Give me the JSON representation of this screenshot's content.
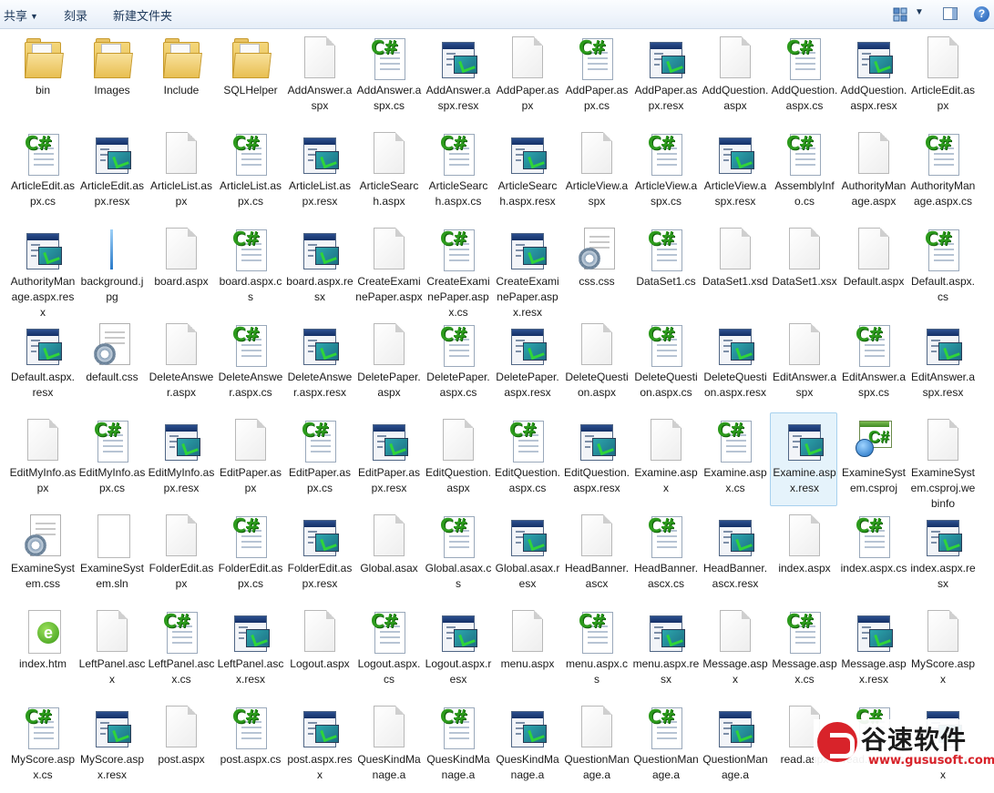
{
  "toolbar": {
    "share_label": "共享",
    "burn_label": "刻录",
    "new_folder_label": "新建文件夹",
    "help_label": "?"
  },
  "files": [
    {
      "name": "bin",
      "type": "folder"
    },
    {
      "name": "Images",
      "type": "folder"
    },
    {
      "name": "Include",
      "type": "folder"
    },
    {
      "name": "SQLHelper",
      "type": "folder"
    },
    {
      "name": "AddAnswer.aspx",
      "type": "page"
    },
    {
      "name": "AddAnswer.aspx.cs",
      "type": "cs"
    },
    {
      "name": "AddAnswer.aspx.resx",
      "type": "resx"
    },
    {
      "name": "AddPaper.aspx",
      "type": "page"
    },
    {
      "name": "AddPaper.aspx.cs",
      "type": "cs"
    },
    {
      "name": "AddPaper.aspx.resx",
      "type": "resx"
    },
    {
      "name": "AddQuestion.aspx",
      "type": "page"
    },
    {
      "name": "AddQuestion.aspx.cs",
      "type": "cs"
    },
    {
      "name": "AddQuestion.aspx.resx",
      "type": "resx"
    },
    {
      "name": "ArticleEdit.aspx",
      "type": "page"
    },
    {
      "name": "ArticleEdit.aspx.cs",
      "type": "cs"
    },
    {
      "name": "ArticleEdit.aspx.resx",
      "type": "resx"
    },
    {
      "name": "ArticleList.aspx",
      "type": "page"
    },
    {
      "name": "ArticleList.aspx.cs",
      "type": "cs"
    },
    {
      "name": "ArticleList.aspx.resx",
      "type": "resx"
    },
    {
      "name": "ArticleSearch.aspx",
      "type": "page"
    },
    {
      "name": "ArticleSearch.aspx.cs",
      "type": "cs"
    },
    {
      "name": "ArticleSearch.aspx.resx",
      "type": "resx"
    },
    {
      "name": "ArticleView.aspx",
      "type": "page"
    },
    {
      "name": "ArticleView.aspx.cs",
      "type": "cs"
    },
    {
      "name": "ArticleView.aspx.resx",
      "type": "resx"
    },
    {
      "name": "AssemblyInfo.cs",
      "type": "cs"
    },
    {
      "name": "AuthorityManage.aspx",
      "type": "page"
    },
    {
      "name": "AuthorityManage.aspx.cs",
      "type": "cs"
    },
    {
      "name": "AuthorityManage.aspx.resx",
      "type": "resx"
    },
    {
      "name": "background.jpg",
      "type": "jpg"
    },
    {
      "name": "board.aspx",
      "type": "page"
    },
    {
      "name": "board.aspx.cs",
      "type": "cs"
    },
    {
      "name": "board.aspx.resx",
      "type": "resx"
    },
    {
      "name": "CreateExaminePaper.aspx",
      "type": "page"
    },
    {
      "name": "CreateExaminePaper.aspx.cs",
      "type": "cs"
    },
    {
      "name": "CreateExaminePaper.aspx.resx",
      "type": "resx"
    },
    {
      "name": "css.css",
      "type": "css"
    },
    {
      "name": "DataSet1.cs",
      "type": "cs"
    },
    {
      "name": "DataSet1.xsd",
      "type": "page"
    },
    {
      "name": "DataSet1.xsx",
      "type": "page"
    },
    {
      "name": "Default.aspx",
      "type": "page"
    },
    {
      "name": "Default.aspx.cs",
      "type": "cs"
    },
    {
      "name": "Default.aspx.resx",
      "type": "resx"
    },
    {
      "name": "default.css",
      "type": "css"
    },
    {
      "name": "DeleteAnswer.aspx",
      "type": "page"
    },
    {
      "name": "DeleteAnswer.aspx.cs",
      "type": "cs"
    },
    {
      "name": "DeleteAnswer.aspx.resx",
      "type": "resx"
    },
    {
      "name": "DeletePaper.aspx",
      "type": "page"
    },
    {
      "name": "DeletePaper.aspx.cs",
      "type": "cs"
    },
    {
      "name": "DeletePaper.aspx.resx",
      "type": "resx"
    },
    {
      "name": "DeleteQuestion.aspx",
      "type": "page"
    },
    {
      "name": "DeleteQuestion.aspx.cs",
      "type": "cs"
    },
    {
      "name": "DeleteQuestion.aspx.resx",
      "type": "resx"
    },
    {
      "name": "EditAnswer.aspx",
      "type": "page"
    },
    {
      "name": "EditAnswer.aspx.cs",
      "type": "cs"
    },
    {
      "name": "EditAnswer.aspx.resx",
      "type": "resx"
    },
    {
      "name": "EditMyInfo.aspx",
      "type": "page"
    },
    {
      "name": "EditMyInfo.aspx.cs",
      "type": "cs"
    },
    {
      "name": "EditMyInfo.aspx.resx",
      "type": "resx"
    },
    {
      "name": "EditPaper.aspx",
      "type": "page"
    },
    {
      "name": "EditPaper.aspx.cs",
      "type": "cs"
    },
    {
      "name": "EditPaper.aspx.resx",
      "type": "resx"
    },
    {
      "name": "EditQuestion.aspx",
      "type": "page"
    },
    {
      "name": "EditQuestion.aspx.cs",
      "type": "cs"
    },
    {
      "name": "EditQuestion.aspx.resx",
      "type": "resx"
    },
    {
      "name": "Examine.aspx",
      "type": "page"
    },
    {
      "name": "Examine.aspx.cs",
      "type": "cs"
    },
    {
      "name": "Examine.aspx.resx",
      "type": "resx",
      "selected": true
    },
    {
      "name": "ExamineSystem.csproj",
      "type": "csproj"
    },
    {
      "name": "ExamineSystem.csproj.webinfo",
      "type": "page"
    },
    {
      "name": "ExamineSystem.css",
      "type": "css"
    },
    {
      "name": "ExamineSystem.sln",
      "type": "sln"
    },
    {
      "name": "FolderEdit.aspx",
      "type": "page"
    },
    {
      "name": "FolderEdit.aspx.cs",
      "type": "cs"
    },
    {
      "name": "FolderEdit.aspx.resx",
      "type": "resx"
    },
    {
      "name": "Global.asax",
      "type": "page"
    },
    {
      "name": "Global.asax.cs",
      "type": "cs"
    },
    {
      "name": "Global.asax.resx",
      "type": "resx"
    },
    {
      "name": "HeadBanner.ascx",
      "type": "page"
    },
    {
      "name": "HeadBanner.ascx.cs",
      "type": "cs"
    },
    {
      "name": "HeadBanner.ascx.resx",
      "type": "resx"
    },
    {
      "name": "index.aspx",
      "type": "page"
    },
    {
      "name": "index.aspx.cs",
      "type": "cs"
    },
    {
      "name": "index.aspx.resx",
      "type": "resx"
    },
    {
      "name": "index.htm",
      "type": "htm"
    },
    {
      "name": "LeftPanel.ascx",
      "type": "page"
    },
    {
      "name": "LeftPanel.ascx.cs",
      "type": "cs"
    },
    {
      "name": "LeftPanel.ascx.resx",
      "type": "resx"
    },
    {
      "name": "Logout.aspx",
      "type": "page"
    },
    {
      "name": "Logout.aspx.cs",
      "type": "cs"
    },
    {
      "name": "Logout.aspx.resx",
      "type": "resx"
    },
    {
      "name": "menu.aspx",
      "type": "page"
    },
    {
      "name": "menu.aspx.cs",
      "type": "cs"
    },
    {
      "name": "menu.aspx.resx",
      "type": "resx"
    },
    {
      "name": "Message.aspx",
      "type": "page"
    },
    {
      "name": "Message.aspx.cs",
      "type": "cs"
    },
    {
      "name": "Message.aspx.resx",
      "type": "resx"
    },
    {
      "name": "MyScore.aspx",
      "type": "page"
    },
    {
      "name": "MyScore.aspx.cs",
      "type": "cs"
    },
    {
      "name": "MyScore.aspx.resx",
      "type": "resx"
    },
    {
      "name": "post.aspx",
      "type": "page"
    },
    {
      "name": "post.aspx.cs",
      "type": "cs"
    },
    {
      "name": "post.aspx.resx",
      "type": "resx"
    },
    {
      "name": "QuesKindManage.a",
      "type": "page"
    },
    {
      "name": "QuesKindManage.a",
      "type": "cs"
    },
    {
      "name": "QuesKindManage.a",
      "type": "resx"
    },
    {
      "name": "QuestionManage.a",
      "type": "page"
    },
    {
      "name": "QuestionManage.a",
      "type": "cs"
    },
    {
      "name": "QuestionManage.a",
      "type": "resx"
    },
    {
      "name": "read.aspx",
      "type": "page"
    },
    {
      "name": "read.aspx.cs",
      "type": "cs"
    },
    {
      "name": "read.aspx.resx",
      "type": "resx"
    }
  ],
  "watermark": {
    "brand": "谷速软件",
    "url": "www.gususoft.com"
  }
}
